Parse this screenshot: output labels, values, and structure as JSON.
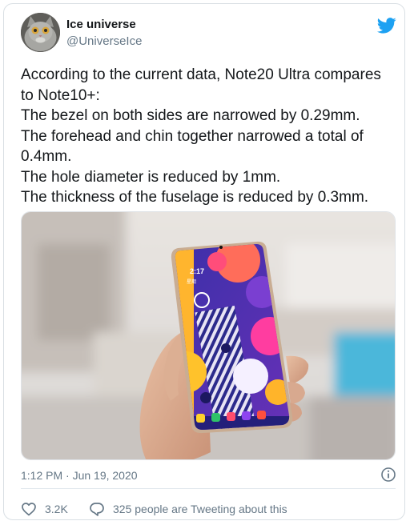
{
  "author": {
    "name": "Ice universe",
    "handle": "@UniverseIce",
    "avatar_icon": "cat-avatar"
  },
  "tweet": {
    "lines": [
      "According to the current data, Note20 Ultra compares",
      "to Note10+:",
      "The bezel on both sides are narrowed by 0.29mm.",
      "The forehead and chin together narrowed a total of",
      "0.4mm.",
      "The hole diameter is reduced by 1mm.",
      "The thickness of the fuselage is reduced by 0.3mm."
    ],
    "timestamp": "1:12 PM · Jun 19, 2020"
  },
  "phone_screen": {
    "clock": "2:17",
    "date": "星期"
  },
  "actions": {
    "like_count": "3.2K",
    "reply_label": "325 people are Tweeting about this"
  },
  "colors": {
    "twitter_blue": "#1da1f2",
    "muted_text": "#657786",
    "body_text": "#14171a",
    "divider": "#e1e8ed"
  }
}
